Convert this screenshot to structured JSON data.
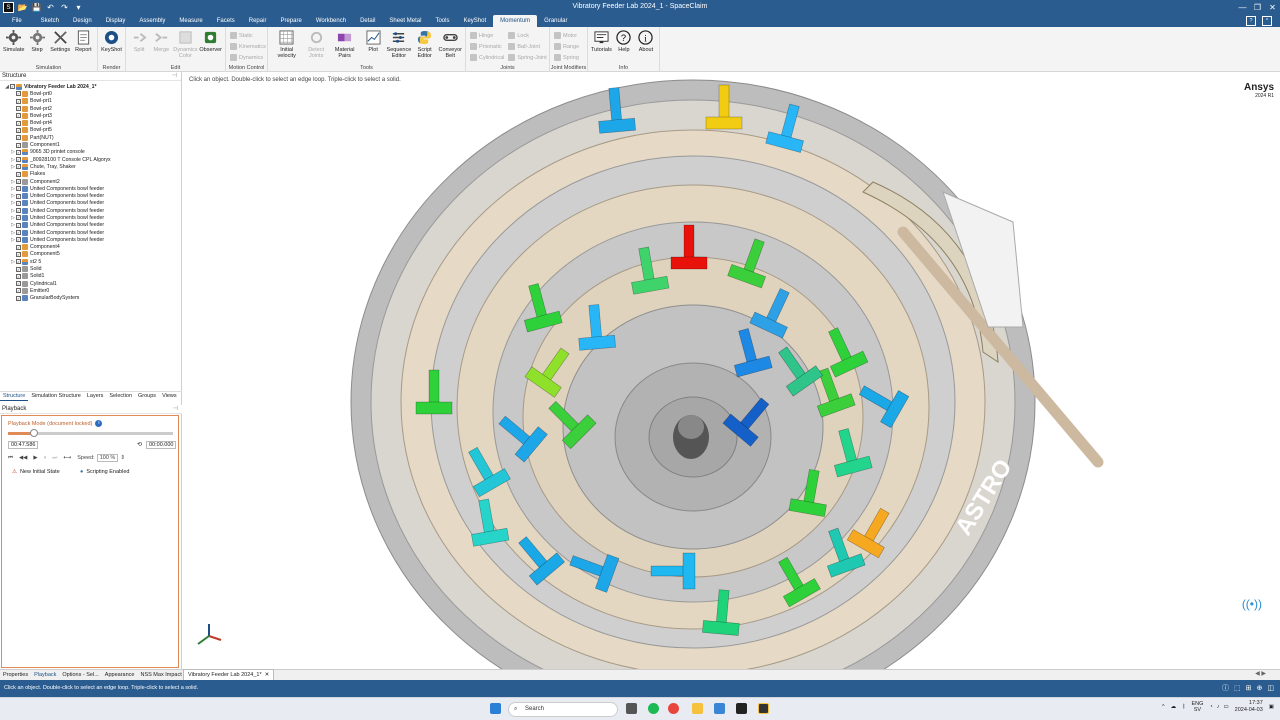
{
  "window": {
    "title": "Vibratory Feeder Lab 2024_1 - SpaceClaim"
  },
  "menu_tabs": [
    {
      "label": "File",
      "active": false
    },
    {
      "label": "Sketch",
      "active": false
    },
    {
      "label": "Design",
      "active": false
    },
    {
      "label": "Display",
      "active": false
    },
    {
      "label": "Assembly",
      "active": false
    },
    {
      "label": "Measure",
      "active": false
    },
    {
      "label": "Facets",
      "active": false
    },
    {
      "label": "Repair",
      "active": false
    },
    {
      "label": "Prepare",
      "active": false
    },
    {
      "label": "Workbench",
      "active": false
    },
    {
      "label": "Detail",
      "active": false
    },
    {
      "label": "Sheet Metal",
      "active": false
    },
    {
      "label": "Tools",
      "active": false
    },
    {
      "label": "KeyShot",
      "active": false
    },
    {
      "label": "Momentum",
      "active": true
    },
    {
      "label": "Granular",
      "active": false
    }
  ],
  "ribbon": {
    "simulation": {
      "label": "Simulation",
      "simulate": "Simulate",
      "step": "Step",
      "settings": "Settings",
      "report": "Report"
    },
    "render": {
      "label": "Render",
      "keyshot": "KeyShot"
    },
    "edit": {
      "label": "Edit",
      "split": "Split",
      "merge": "Merge",
      "dynamics_color": "Dynamics Color",
      "observer": "Observer"
    },
    "motion_control": {
      "label": "Motion Control",
      "items": [
        "Static",
        "Kinematics",
        "Dynamics"
      ]
    },
    "tools": {
      "label": "Tools",
      "initial_velocity": "Initial velocity",
      "detect_joints": "Detect Joints",
      "material_pairs": "Material Pairs",
      "plot": "Plot",
      "sequence_editor": "Sequence Editor",
      "script_editor": "Script Editor",
      "conveyor_belt": "Conveyor Belt"
    },
    "joints": {
      "label": "Joints",
      "col1": [
        "Hinge",
        "Prismatic",
        "Cylindrical"
      ],
      "col2": [
        "Lock",
        "Ball-Joint",
        "Spring-Joint"
      ]
    },
    "joint_modifiers": {
      "label": "Joint Modifiers",
      "items": [
        "Motor",
        "Range",
        "Spring"
      ]
    },
    "info": {
      "label": "Info",
      "tutorials": "Tutorials",
      "help": "Help",
      "about": "About"
    }
  },
  "structure": {
    "header": "Structure",
    "items": [
      {
        "label": "Vibratory Feeder Lab 2024_1*",
        "icon": "stack",
        "bold": true,
        "indent": 0,
        "exp": "◢"
      },
      {
        "label": "Bowl-prt0",
        "icon": "orange",
        "indent": 1
      },
      {
        "label": "Bowl-prt1",
        "icon": "orange",
        "indent": 1
      },
      {
        "label": "Bowl-prt2",
        "icon": "orange",
        "indent": 1
      },
      {
        "label": "Bowl-prt3",
        "icon": "orange",
        "indent": 1
      },
      {
        "label": "Bowl-prt4",
        "icon": "orange",
        "indent": 1
      },
      {
        "label": "Bowl-prt5",
        "icon": "orange",
        "indent": 1
      },
      {
        "label": "Part(NUT)",
        "icon": "orange",
        "indent": 1
      },
      {
        "label": "Component1",
        "icon": "grey",
        "indent": 1
      },
      {
        "label": "9065 3D printet console",
        "icon": "stack",
        "indent": 1,
        "exp": "▷"
      },
      {
        "label": "_80928100 T Console CPL Algoryx",
        "icon": "stack",
        "indent": 1,
        "exp": "▷"
      },
      {
        "label": "Chute, Tray, Shaker",
        "icon": "stack",
        "indent": 1,
        "exp": "▷"
      },
      {
        "label": "Flakes",
        "icon": "orange",
        "indent": 1
      },
      {
        "label": "Component2",
        "icon": "grey",
        "indent": 1,
        "exp": "▷"
      },
      {
        "label": "United Components bowl feeder",
        "icon": "blue",
        "indent": 1,
        "exp": "▷"
      },
      {
        "label": "United Components bowl feeder",
        "icon": "blue",
        "indent": 1,
        "exp": "▷"
      },
      {
        "label": "United Components bowl feeder",
        "icon": "blue",
        "indent": 1,
        "exp": "▷"
      },
      {
        "label": "United Components bowl feeder",
        "icon": "blue",
        "indent": 1,
        "exp": "▷"
      },
      {
        "label": "United Components bowl feeder",
        "icon": "blue",
        "indent": 1,
        "exp": "▷"
      },
      {
        "label": "United Components bowl feeder",
        "icon": "blue",
        "indent": 1,
        "exp": "▷"
      },
      {
        "label": "United Components bowl feeder",
        "icon": "blue",
        "indent": 1,
        "exp": "▷"
      },
      {
        "label": "United Components bowl feeder",
        "icon": "blue",
        "indent": 1,
        "exp": "▷"
      },
      {
        "label": "Component4",
        "icon": "orange",
        "indent": 1
      },
      {
        "label": "Component5",
        "icon": "orange",
        "indent": 1
      },
      {
        "label": "st2 5",
        "icon": "stack",
        "indent": 1,
        "exp": "▷"
      },
      {
        "label": "Solid",
        "icon": "grey",
        "indent": 1
      },
      {
        "label": "Solid1",
        "icon": "grey",
        "indent": 1
      },
      {
        "label": "Cylindrical1",
        "icon": "grey",
        "indent": 1
      },
      {
        "label": "Emitter0",
        "icon": "grey",
        "indent": 1
      },
      {
        "label": "GranularBodySystem",
        "icon": "blue",
        "indent": 1
      }
    ]
  },
  "pane_tabs": [
    {
      "label": "Structure",
      "active": true
    },
    {
      "label": "Simulation Structure",
      "active": false
    },
    {
      "label": "Layers",
      "active": false
    },
    {
      "label": "Selection",
      "active": false
    },
    {
      "label": "Groups",
      "active": false
    },
    {
      "label": "Views",
      "active": false
    }
  ],
  "playback": {
    "header": "Playback",
    "mode": "Playback Mode (document locked)",
    "progress": 0.16,
    "current_time": "00:47.586",
    "end_time": "00:00.000",
    "speed_label": "Speed:",
    "speed_value": "100 %",
    "new_initial_state": "New Initial State",
    "scripting": "Scripting Enabled"
  },
  "bottom_tabs": [
    {
      "label": "Properties",
      "active": false
    },
    {
      "label": "Playback",
      "active": true
    },
    {
      "label": "Options - Sel...",
      "active": false
    },
    {
      "label": "Appearance",
      "active": false
    },
    {
      "label": "NSS Max Impact E...",
      "active": false
    }
  ],
  "document_tab": "Vibratory Feeder Lab 2024_1*",
  "viewport": {
    "hint": "Click an object. Double-click to select an edge loop. Triple-click to select a solid.",
    "brand": "Ansys",
    "version": "2024 R1",
    "bowl_text": "ASTRO"
  },
  "status": {
    "message": "Click an object. Double-click to select an edge loop. Triple-click to select a solid."
  },
  "taskbar": {
    "search": "Search",
    "lang": "ENG",
    "region": "SV",
    "time": "17:37",
    "date": "2024-04-03"
  },
  "colors": {
    "accent": "#2b5c8f",
    "panel_border": "#e08a55",
    "red_part": "#e8120a",
    "yellow_part": "#f2cc12",
    "orange_part": "#f5a820"
  }
}
